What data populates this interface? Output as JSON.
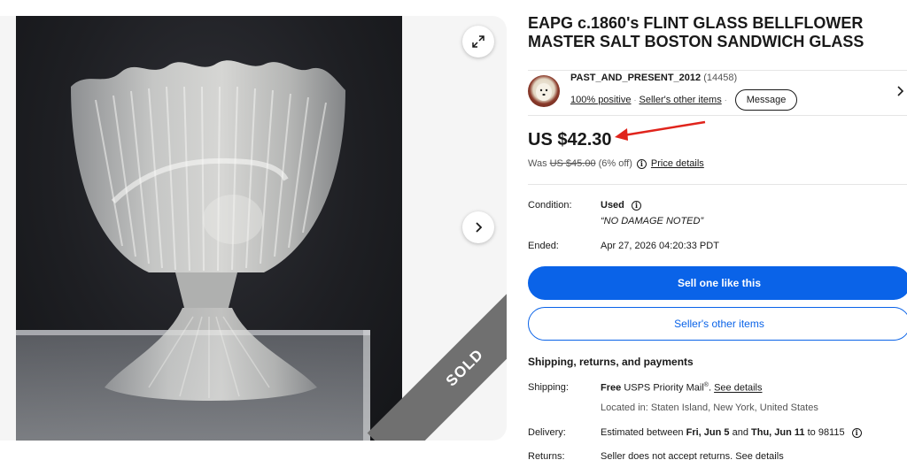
{
  "gallery": {
    "sold_ribbon": "SOLD",
    "icons": {
      "expand": "expand-icon",
      "next": "chevron-right-icon"
    }
  },
  "listing": {
    "title": "EAPG c.1860's FLINT GLASS BELLFLOWER MASTER SALT BOSTON SANDWICH GLASS"
  },
  "seller": {
    "name": "PAST_AND_PRESENT_2012",
    "score": "(14458)",
    "positive": "100% positive",
    "other_items_link": "Seller's other items",
    "message_button": "Message"
  },
  "price": {
    "current": "US $42.30",
    "was_label": "Was",
    "was_value": "US $45.00",
    "discount": "(6% off)",
    "details_link": "Price details"
  },
  "details": {
    "condition_label": "Condition:",
    "condition_value": "Used",
    "condition_note": "“NO DAMAGE NOTED”",
    "ended_label": "Ended:",
    "ended_value": "Apr 27, 2026 04:20:33 PDT"
  },
  "actions": {
    "sell_one": "Sell one like this",
    "sellers_items": "Seller's other items"
  },
  "shipping": {
    "heading": "Shipping, returns, and payments",
    "shipping_label": "Shipping:",
    "shipping_free": "Free",
    "shipping_service": "USPS Priority Mail",
    "shipping_reg": "®",
    "shipping_details": "See details",
    "location": "Located in: Staten Island, New York, United States",
    "delivery_label": "Delivery:",
    "delivery_prefix": "Estimated between",
    "delivery_start": "Fri, Jun 5",
    "delivery_and": "and",
    "delivery_end": "Thu, Jun 11",
    "delivery_to": "to 98115",
    "returns_label": "Returns:",
    "returns_value": "Seller does not accept returns.",
    "returns_details": "See details"
  },
  "colors": {
    "primary_blue": "#0a63e8",
    "annotation_red": "#e0241c",
    "ribbon_gray": "#707070"
  }
}
